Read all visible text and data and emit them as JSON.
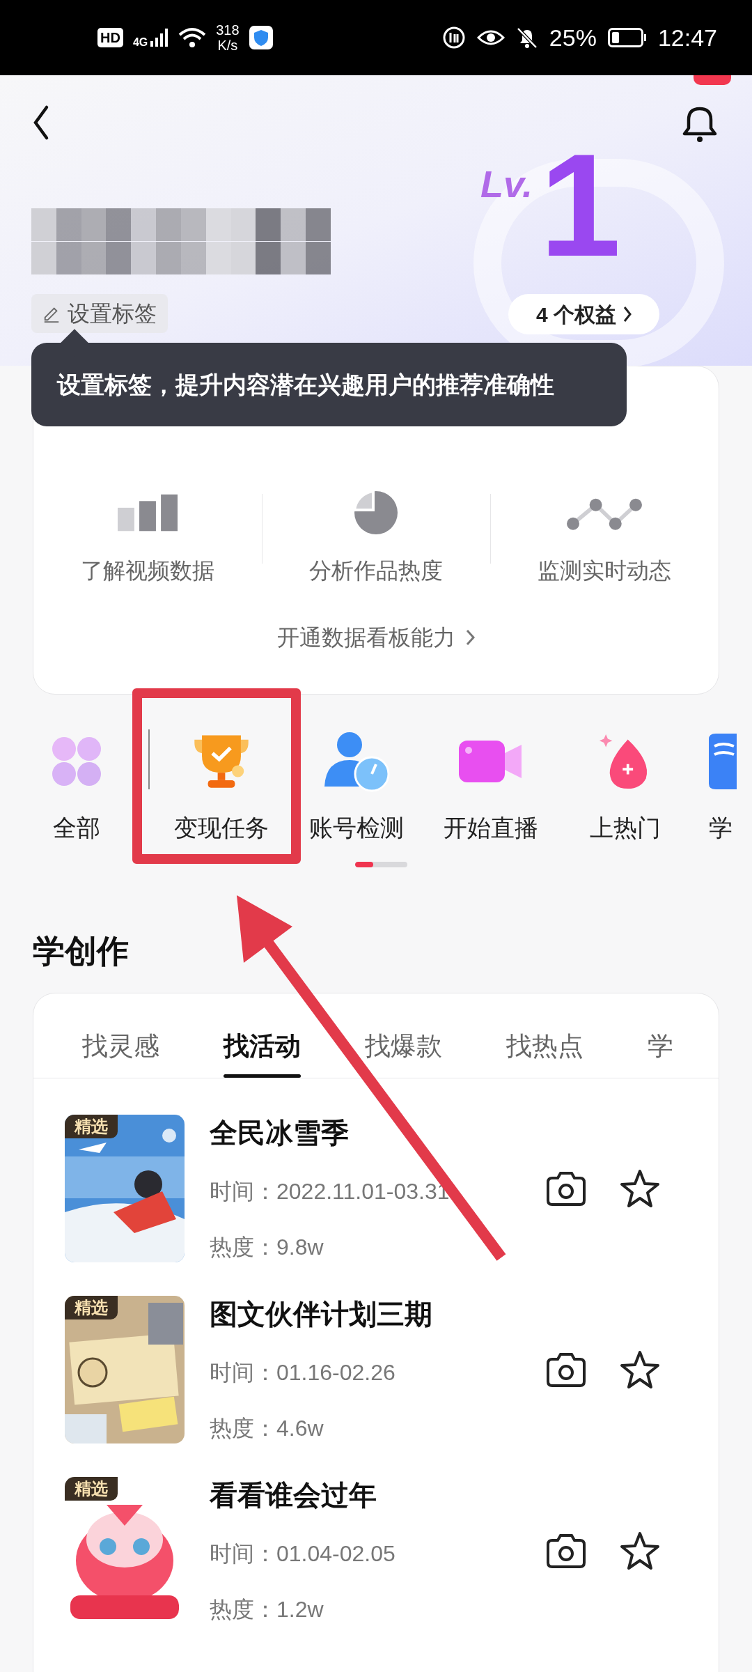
{
  "status_bar": {
    "hd": "HD",
    "network": "4G",
    "speed": "318",
    "speed_unit": "K/s",
    "battery": "25%",
    "time": "12:47"
  },
  "header": {
    "tag_button": "设置标签",
    "level_prefix": "Lv.",
    "level": "1",
    "benefits": "4 个权益",
    "tooltip": "设置标签，提升内容潜在兴趣用户的推荐准确性"
  },
  "data_card": {
    "features": [
      {
        "kind": "bars",
        "label": "了解视频数据"
      },
      {
        "kind": "pie",
        "label": "分析作品热度"
      },
      {
        "kind": "line",
        "label": "监测实时动态"
      }
    ],
    "link": "开通数据看板能力"
  },
  "shortcuts": [
    {
      "kind": "grid",
      "label": "全部"
    },
    {
      "kind": "trophy",
      "label": "变现任务"
    },
    {
      "kind": "account",
      "label": "账号检测"
    },
    {
      "kind": "video",
      "label": "开始直播"
    },
    {
      "kind": "drop",
      "label": "上热门"
    },
    {
      "kind": "book",
      "label": "学"
    }
  ],
  "section_title": "学创作",
  "tabs": [
    {
      "label": "找灵感",
      "selected": false
    },
    {
      "label": "找活动",
      "selected": true
    },
    {
      "label": "找爆款",
      "selected": false
    },
    {
      "label": "找热点",
      "selected": false
    },
    {
      "label": "学",
      "selected": false
    }
  ],
  "activities": [
    {
      "badge": "精选",
      "title": "全民冰雪季",
      "time": "时间：2022.11.01-03.31",
      "heat": "热度：9.8w"
    },
    {
      "badge": "精选",
      "title": "图文伙伴计划三期",
      "time": "时间：01.16-02.26",
      "heat": "热度：4.6w"
    },
    {
      "badge": "精选",
      "title": "看看谁会过年",
      "time": "时间：01.04-02.05",
      "heat": "热度：1.2w"
    }
  ]
}
